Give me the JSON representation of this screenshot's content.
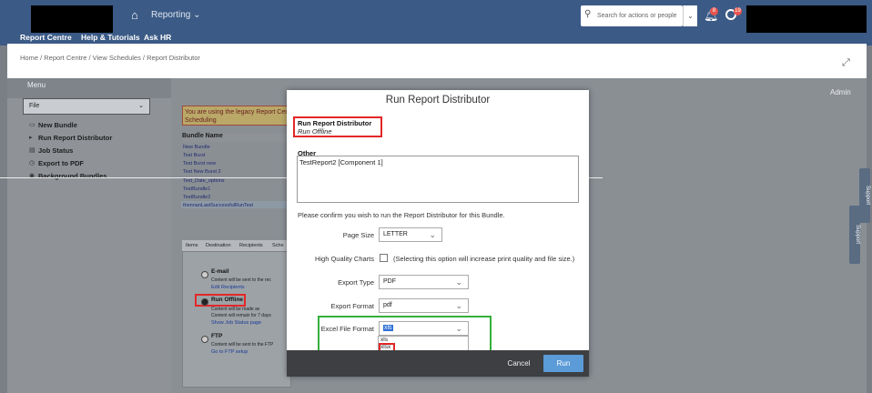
{
  "topbar": {
    "module": "Reporting",
    "nav": [
      "Report Centre",
      "Help & Tutorials",
      "Ask HR"
    ],
    "search_placeholder": "Search for actions or people",
    "notification_badge": "8",
    "tasks_badge": "19"
  },
  "breadcrumb": "Home / Report Centre / View Schedules / Report Distributor",
  "sidebar": {
    "menu_title": "Menu",
    "file_select": "File",
    "items": [
      "New Bundle",
      "Run Report Distributor",
      "Job Status",
      "Export to PDF",
      "Background Bundles"
    ]
  },
  "user": "Admin",
  "legacy_notice": "You are using the legacy Report Centre Scheduling",
  "bundles": {
    "header": "Bundle Name",
    "rows": [
      "New Bundle",
      "Test Burst",
      "Test Burst new",
      "Test New Burst 2",
      "Test_Date_options",
      "TestBundle1",
      "TestBundle2",
      "thennanLastSuccessfulRunTest"
    ]
  },
  "tabs": [
    "Items",
    "Destination",
    "Recipients",
    "Sche"
  ],
  "options": {
    "email_title": "E-mail",
    "email_text": "Content will be sent to the rec",
    "email_link": "Edit Recipients",
    "offline_title": "Run Offline",
    "offline_text1": "Content will be made av",
    "offline_text2": "Content will remain for 7 days",
    "offline_link": "Show Job Status page",
    "ftp_title": "FTP",
    "ftp_text": "Content will be sent to the FTP",
    "ftp_link": "Go to FTP setup"
  },
  "side_tab": "Support",
  "modal": {
    "title": "Run Report Distributor",
    "section_title": "Run Report Distributor",
    "section_subtitle": "Run Offline",
    "other_label": "Other",
    "other_value": "TestReport2 [Component 1]",
    "confirm_text": "Please confirm you wish to run the Report Distributor for this Bundle.",
    "page_size_label": "Page Size",
    "page_size_value": "LETTER",
    "hq_label": "High Quality Charts",
    "hq_note": "(Selecting this option will increase print quality and file size.)",
    "export_type_label": "Export Type",
    "export_type_value": "PDF",
    "export_format_label": "Export Format",
    "export_format_value": "pdf",
    "excel_label": "Excel File Format",
    "excel_value": "xls",
    "excel_options": [
      "xls",
      "xlsx"
    ],
    "cancel": "Cancel",
    "run": "Run"
  }
}
